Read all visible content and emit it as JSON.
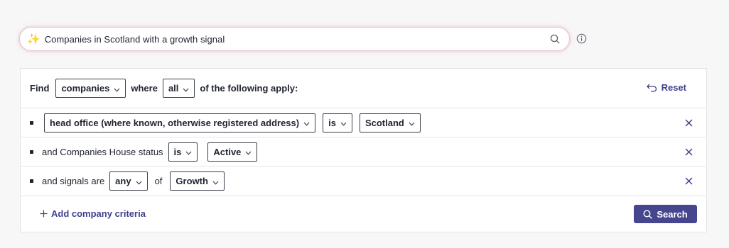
{
  "ai_search": {
    "sparkle_icon": "sparkles-icon",
    "query": "Companies in Scotland with a growth signal"
  },
  "builder": {
    "find_label": "Find",
    "entity_select": "companies",
    "where_label": "where",
    "match_select": "all",
    "apply_label": "of the following apply:",
    "reset_label": "Reset",
    "criteria": [
      {
        "field_select": "head office (where known, otherwise registered address)",
        "operator_select": "is",
        "value_select": "Scotland"
      },
      {
        "prefix": "and Companies House status",
        "operator_select": "is",
        "value_select": "Active"
      },
      {
        "prefix": "and signals are",
        "operator_select": "any",
        "of_label": "of",
        "value_select": "Growth"
      }
    ],
    "add_criteria_label": "Add company criteria",
    "search_label": "Search"
  },
  "colors": {
    "accent": "#46468e",
    "link": "#3f3f8f",
    "border": "#e1e3e8",
    "background": "#f7f7f8"
  }
}
